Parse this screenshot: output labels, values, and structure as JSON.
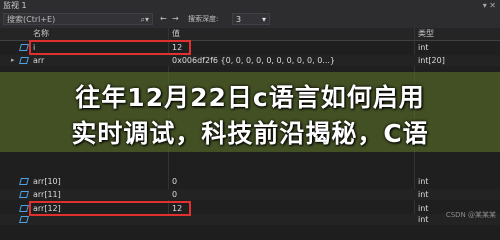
{
  "window": {
    "title": "监视 1"
  },
  "toolbar": {
    "search_left": "搜索(Ctrl+E)",
    "search_right": "搜索深度:",
    "depth_value": "3"
  },
  "columns": {
    "name": "名称",
    "value": "值",
    "type": "类型"
  },
  "rows": [
    {
      "name": "i",
      "value": "12",
      "type": "int"
    },
    {
      "name": "arr",
      "value": "0x006df2f6 {0, 0, 0, 0, 0, 0, 0, 0, 0, 0...}",
      "type": "int[20]"
    },
    {
      "name": "arr[10]",
      "value": "0",
      "type": "int"
    },
    {
      "name": "arr[11]",
      "value": "0",
      "type": "int"
    },
    {
      "name": "arr[12]",
      "value": "12",
      "type": "int"
    },
    {
      "name": "",
      "value": "",
      "type": "int"
    }
  ],
  "overlay": {
    "line1": "往年12月22日c语言如何启用",
    "line2": "实时调试，科技前沿揭秘，C语"
  },
  "watermark": "CSDN @某某某",
  "colors": {
    "highlight": "#e03030",
    "band": "#5a7028"
  }
}
